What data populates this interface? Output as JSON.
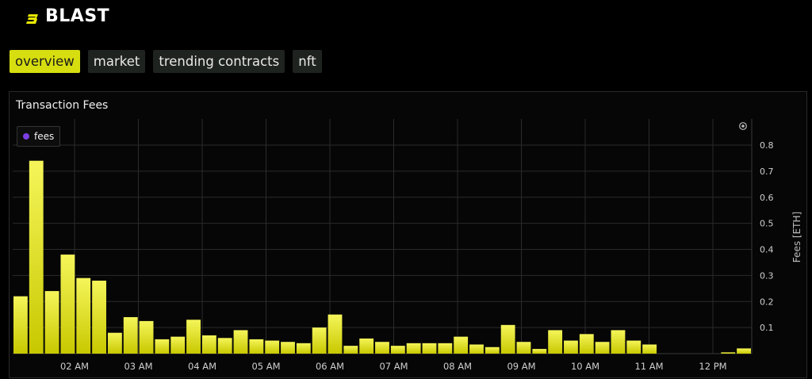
{
  "brand": {
    "name": "BLAST",
    "logo_icon": "blast-logo-icon"
  },
  "tabs": [
    {
      "label": "overview",
      "active": true
    },
    {
      "label": "market",
      "active": false
    },
    {
      "label": "trending contracts",
      "active": false
    },
    {
      "label": "nft",
      "active": false
    }
  ],
  "panel": {
    "title": "Transaction Fees"
  },
  "colors": {
    "bar": "#c8c800",
    "bar_highlight": "#f5f55a",
    "accent": "#d7de10",
    "legend_dot": "#7b3fe4"
  },
  "chart_data": {
    "type": "bar",
    "title": "Transaction Fees",
    "ylabel": "Fees [ETH]",
    "ylim": [
      0,
      0.8
    ],
    "y_ticks": [
      "0.1",
      "0.2",
      "0.3",
      "0.4",
      "0.5",
      "0.6",
      "0.7",
      "0.8"
    ],
    "x_ticks": [
      "02 AM",
      "03 AM",
      "04 AM",
      "05 AM",
      "06 AM",
      "07 AM",
      "08 AM",
      "09 AM",
      "10 AM",
      "11 AM",
      "12 PM"
    ],
    "legend_position": "top-left",
    "grid": true,
    "series": [
      {
        "name": "fees",
        "values": [
          0.22,
          0.74,
          0.24,
          0.38,
          0.29,
          0.28,
          0.08,
          0.14,
          0.125,
          0.055,
          0.065,
          0.13,
          0.07,
          0.06,
          0.09,
          0.055,
          0.05,
          0.045,
          0.04,
          0.1,
          0.15,
          0.03,
          0.058,
          0.045,
          0.03,
          0.04,
          0.04,
          0.04,
          0.065,
          0.035,
          0.025,
          0.11,
          0.045,
          0.018,
          0.09,
          0.05,
          0.075,
          0.045,
          0.09,
          0.05,
          0.035,
          0,
          0,
          0,
          0,
          0.005,
          0.02
        ]
      }
    ]
  }
}
